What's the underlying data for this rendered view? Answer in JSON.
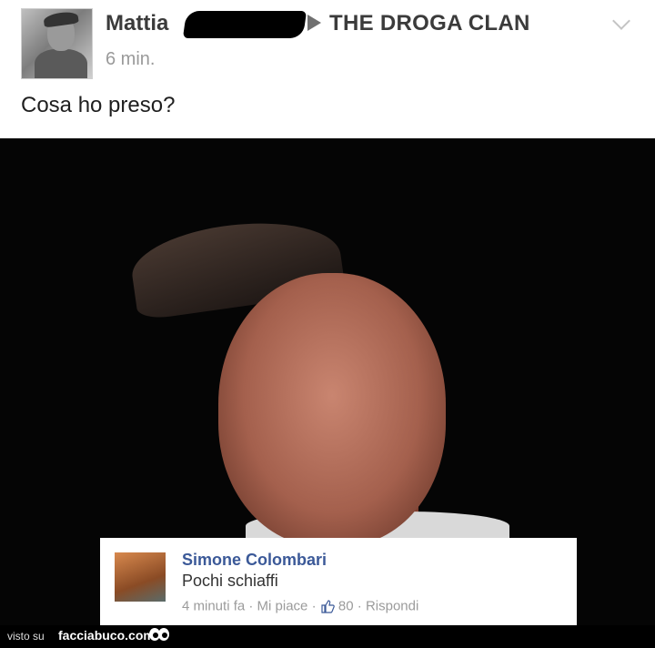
{
  "post": {
    "author": "Mattia",
    "group": "THE DROGA CLAN",
    "time": "6 min.",
    "text": "Cosa ho preso?"
  },
  "comment": {
    "name": "Simone Colombari",
    "text": "Pochi schiaffi",
    "time": "4 minuti fa",
    "like": "Mi piace",
    "sep": "·",
    "likes": "80",
    "reply": "Rispondi"
  },
  "footer": {
    "visto": "visto su",
    "brand": "facciabuco.com"
  },
  "icons": {
    "arrow": "right-triangle-icon",
    "chevron": "chevron-down-icon",
    "like": "thumbs-up-icon",
    "logo": "eyes-icon"
  }
}
